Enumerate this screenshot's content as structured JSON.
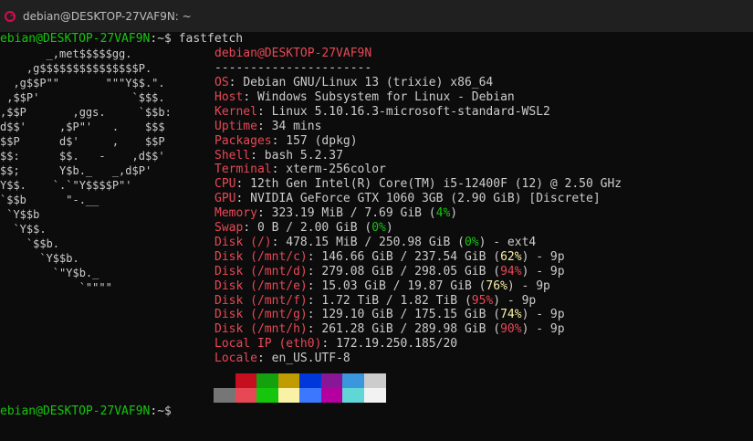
{
  "window": {
    "title": "debian@DESKTOP-27VAF9N: ~",
    "icon": "debian-swirl-icon"
  },
  "prompt": {
    "user_host": "ebian@DESKTOP-27VAF9N",
    "sep": ":~$",
    "command": "fastfetch"
  },
  "logo": [
    "       _,met$$$$$gg.",
    "    ,g$$$$$$$$$$$$$$$P.",
    "  ,g$$P\"\"       \"\"\"Y$$.\".",
    " ,$$P'              `$$$.",
    ",$$P       ,ggs.     `$$b:",
    "d$$'     ,$P\"'   .    $$$",
    "$$P      d$'     ,    $$P",
    "$$:      $$.   -    ,d$$'",
    "$$;      Y$b._   _,d$P'",
    "Y$$.    `.`\"Y$$$$P\"'",
    "`$$b      \"-.__",
    " `Y$$b",
    "  `Y$$.",
    "    `$$b.",
    "      `Y$$b.",
    "        `\"Y$b._",
    "            `\"\"\"\""
  ],
  "header": {
    "user_host": "debian@DESKTOP-27VAF9N",
    "separator": "----------------------"
  },
  "info": [
    {
      "key": "OS",
      "value": "Debian GNU/Linux 13 (trixie) x86_64"
    },
    {
      "key": "Host",
      "value": "Windows Subsystem for Linux - Debian"
    },
    {
      "key": "Kernel",
      "value": "Linux 5.10.16.3-microsoft-standard-WSL2"
    },
    {
      "key": "Uptime",
      "value": "34 mins"
    },
    {
      "key": "Packages",
      "value": "157 (dpkg)"
    },
    {
      "key": "Shell",
      "value": "bash 5.2.37"
    },
    {
      "key": "Terminal",
      "value": "xterm-256color"
    },
    {
      "key": "CPU",
      "value": "12th Gen Intel(R) Core(TM) i5-12400F (12) @ 2.50 GHz"
    },
    {
      "key": "GPU",
      "value": "NVIDIA GeForce GTX 1060 3GB (2.90 GiB) [Discrete]"
    },
    {
      "key": "Memory",
      "value": "323.19 MiB / 7.69 GiB (",
      "pct": "4%",
      "pct_color": "grn",
      "tail": ")"
    },
    {
      "key": "Swap",
      "value": "0 B / 2.00 GiB (",
      "pct": "0%",
      "pct_color": "grn",
      "tail": ")"
    },
    {
      "key": "Disk (/)",
      "value": "478.15 MiB / 250.98 GiB (",
      "pct": "0%",
      "pct_color": "grn",
      "tail": ") - ext4"
    },
    {
      "key": "Disk (/mnt/c)",
      "value": "146.66 GiB / 237.54 GiB (",
      "pct": "62%",
      "pct_color": "yel",
      "tail": ") - 9p"
    },
    {
      "key": "Disk (/mnt/d)",
      "value": "279.08 GiB / 298.05 GiB (",
      "pct": "94%",
      "pct_color": "rdp",
      "tail": ") - 9p"
    },
    {
      "key": "Disk (/mnt/e)",
      "value": "15.03 GiB / 19.87 GiB (",
      "pct": "76%",
      "pct_color": "yel",
      "tail": ") - 9p"
    },
    {
      "key": "Disk (/mnt/f)",
      "value": "1.72 TiB / 1.82 TiB (",
      "pct": "95%",
      "pct_color": "rdp",
      "tail": ") - 9p"
    },
    {
      "key": "Disk (/mnt/g)",
      "value": "129.10 GiB / 175.15 GiB (",
      "pct": "74%",
      "pct_color": "yel",
      "tail": ") - 9p"
    },
    {
      "key": "Disk (/mnt/h)",
      "value": "261.28 GiB / 289.98 GiB (",
      "pct": "90%",
      "pct_color": "rdp",
      "tail": ") - 9p"
    },
    {
      "key": "Local IP (eth0)",
      "value": "172.19.250.185/20"
    },
    {
      "key": "Locale",
      "value": "en_US.UTF-8"
    }
  ],
  "palette": {
    "top": [
      "#0c0c0c",
      "#c50f1f",
      "#13a10e",
      "#c19c00",
      "#0037da",
      "#881798",
      "#3a96dd",
      "#cccccc"
    ],
    "bottom": [
      "#767676",
      "#e74856",
      "#16c60c",
      "#f9f1a5",
      "#3b78ff",
      "#b4009e",
      "#61d6d6",
      "#f2f2f2"
    ]
  },
  "prompt_end": {
    "user_host": "ebian@DESKTOP-27VAF9N",
    "sep": ":~$"
  }
}
